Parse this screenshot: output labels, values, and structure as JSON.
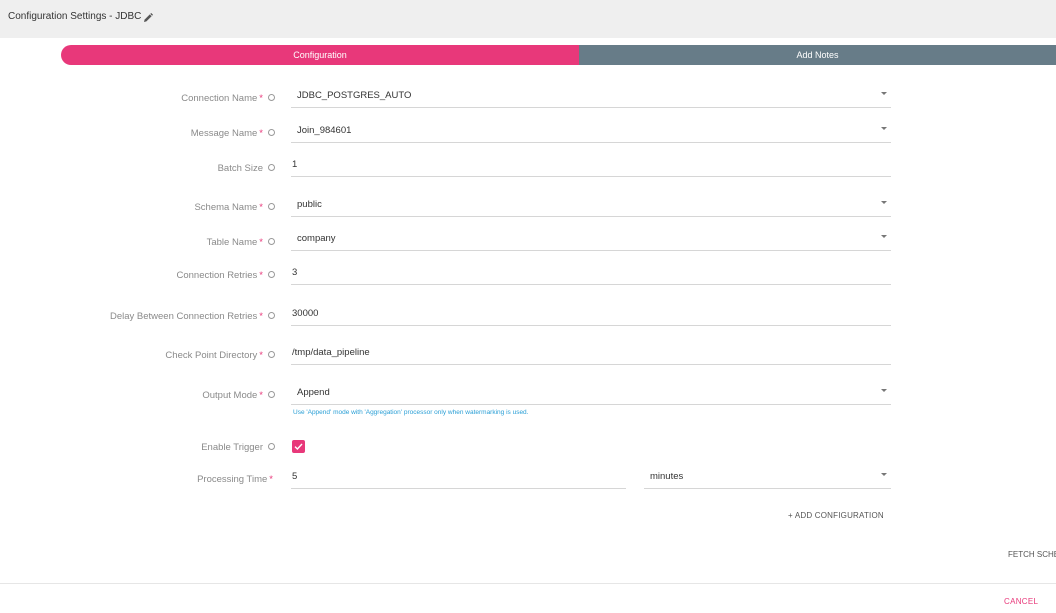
{
  "header": {
    "title": "Configuration Settings -  JDBC",
    "edit_icon": "pencil-icon"
  },
  "stepper": {
    "active_step": "Configuration",
    "next_step": "Add Notes",
    "active_color": "#e8387a",
    "inactive_color": "#677c88"
  },
  "form": {
    "connection_name": {
      "label": "Connection Name",
      "required": "*",
      "value": "JDBC_POSTGRES_AUTO"
    },
    "message_name": {
      "label": "Message Name",
      "required": "*",
      "value": "Join_984601"
    },
    "batch_size": {
      "label": "Batch Size",
      "value": "1"
    },
    "schema_name": {
      "label": "Schema Name",
      "required": "*",
      "value": "public"
    },
    "table_name": {
      "label": "Table Name",
      "required": "*",
      "value": "company"
    },
    "connection_retries": {
      "label": "Connection Retries",
      "required": "*",
      "value": "3"
    },
    "delay_between_retries": {
      "label": "Delay Between Connection Retries",
      "required": "*",
      "value": "30000"
    },
    "checkpoint_directory": {
      "label": "Check Point Directory",
      "required": "*",
      "value": "/tmp/data_pipeline"
    },
    "output_mode": {
      "label": "Output Mode",
      "required": "*",
      "value": "Append",
      "hint": "Use 'Append' mode with 'Aggregation' processor only when watermarking is used."
    },
    "enable_trigger": {
      "label": "Enable Trigger",
      "checked": true
    },
    "processing_time": {
      "label": "Processing Time",
      "required": "*",
      "value": "5",
      "unit": "minutes"
    }
  },
  "actions": {
    "add_configuration": "+ ADD CONFIGURATION",
    "fetch_schema": "FETCH SCHE",
    "cancel": "CANCEL"
  }
}
